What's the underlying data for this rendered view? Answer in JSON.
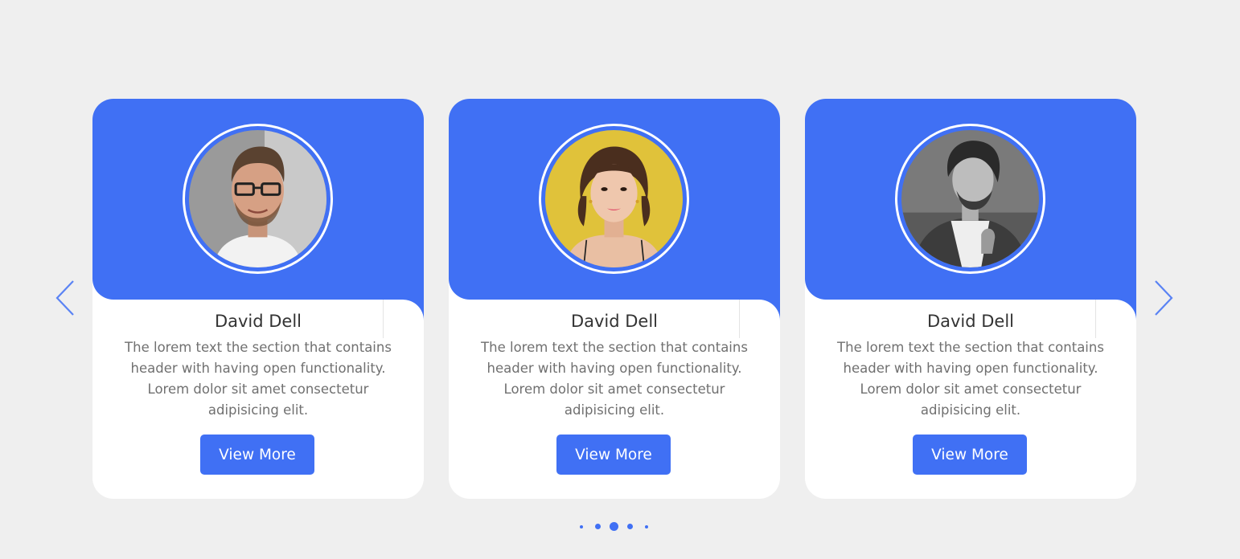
{
  "colors": {
    "accent": "#4070f4",
    "background": "#efefef",
    "card": "#ffffff",
    "name": "#333333",
    "text": "#707070"
  },
  "navigation": {
    "prev_icon": "chevron-left-icon",
    "next_icon": "chevron-right-icon"
  },
  "cards": [
    {
      "name": "David Dell",
      "description": "The lorem text the section that contains header with having open functionality. Lorem dolor sit amet consectetur adipisicing elit.",
      "button_label": "View More",
      "avatar": "man-with-glasses-portrait"
    },
    {
      "name": "David Dell",
      "description": "The lorem text the section that contains header with having open functionality. Lorem dolor sit amet consectetur adipisicing elit.",
      "button_label": "View More",
      "avatar": "woman-yellow-background-portrait"
    },
    {
      "name": "David Dell",
      "description": "The lorem text the section that contains header with having open functionality. Lorem dolor sit amet consectetur adipisicing elit.",
      "button_label": "View More",
      "avatar": "man-denim-jacket-bw-portrait"
    }
  ],
  "pagination": {
    "total": 5,
    "active": 3
  }
}
